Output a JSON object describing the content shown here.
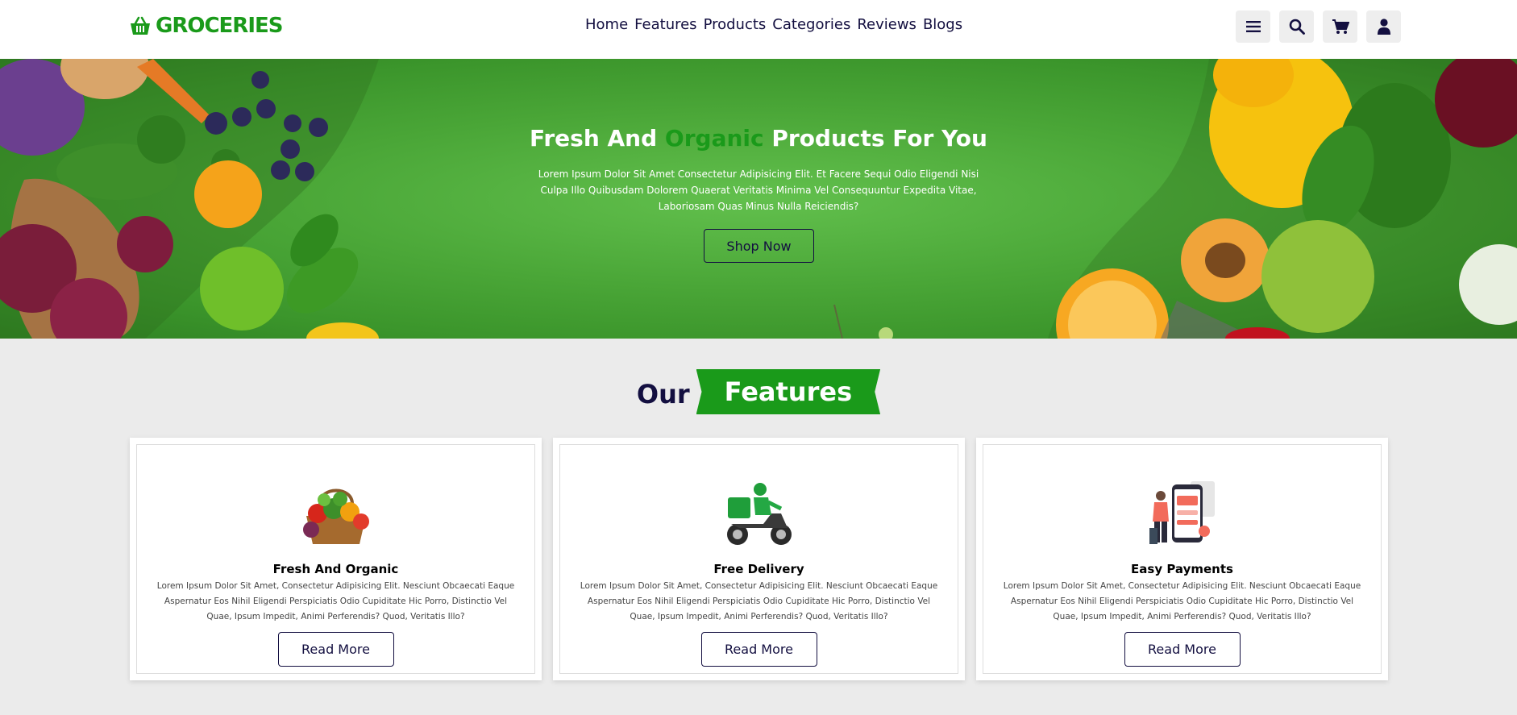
{
  "header": {
    "logo_text": "GROCERIES",
    "nav": [
      "Home",
      "Features",
      "Products",
      "Categories",
      "Reviews",
      "Blogs"
    ],
    "icons": [
      "menu-icon",
      "search-icon",
      "cart-icon",
      "user-icon"
    ]
  },
  "hero": {
    "title_before": "Fresh And ",
    "title_highlight": "Organic",
    "title_after": " Products For You",
    "description": "Lorem Ipsum Dolor Sit Amet Consectetur Adipisicing Elit. Et Facere Sequi Odio Eligendi Nisi Culpa Illo Quibusdam Dolorem Quaerat Veritatis Minima Vel Consequuntur Expedita Vitae, Laboriosam Quas Minus Nulla Reiciendis?",
    "button": "Shop Now"
  },
  "features": {
    "heading_plain": "Our",
    "heading_ribbon": "Features",
    "items": [
      {
        "icon": "vegetable-basket-icon",
        "title": "Fresh And Organic",
        "description": "Lorem Ipsum Dolor Sit Amet, Consectetur Adipisicing Elit. Nesciunt Obcaecati Eaque Aspernatur Eos Nihil Eligendi Perspiciatis Odio Cupiditate Hic Porro, Distinctio Vel Quae, Ipsum Impedit, Animi Perferendis? Quod, Veritatis Illo?",
        "button": "Read More"
      },
      {
        "icon": "delivery-scooter-icon",
        "title": "Free Delivery",
        "description": "Lorem Ipsum Dolor Sit Amet, Consectetur Adipisicing Elit. Nesciunt Obcaecati Eaque Aspernatur Eos Nihil Eligendi Perspiciatis Odio Cupiditate Hic Porro, Distinctio Vel Quae, Ipsum Impedit, Animi Perferendis? Quod, Veritatis Illo?",
        "button": "Read More"
      },
      {
        "icon": "mobile-payment-icon",
        "title": "Easy Payments",
        "description": "Lorem Ipsum Dolor Sit Amet, Consectetur Adipisicing Elit. Nesciunt Obcaecati Eaque Aspernatur Eos Nihil Eligendi Perspiciatis Odio Cupiditate Hic Porro, Distinctio Vel Quae, Ipsum Impedit, Animi Perferendis? Quod, Veritatis Illo?",
        "button": "Read More"
      }
    ]
  },
  "colors": {
    "accent": "#1a9a1a",
    "text_dark": "#130f40",
    "hero_green": "#4aa637",
    "page_bg": "#ebebeb"
  }
}
